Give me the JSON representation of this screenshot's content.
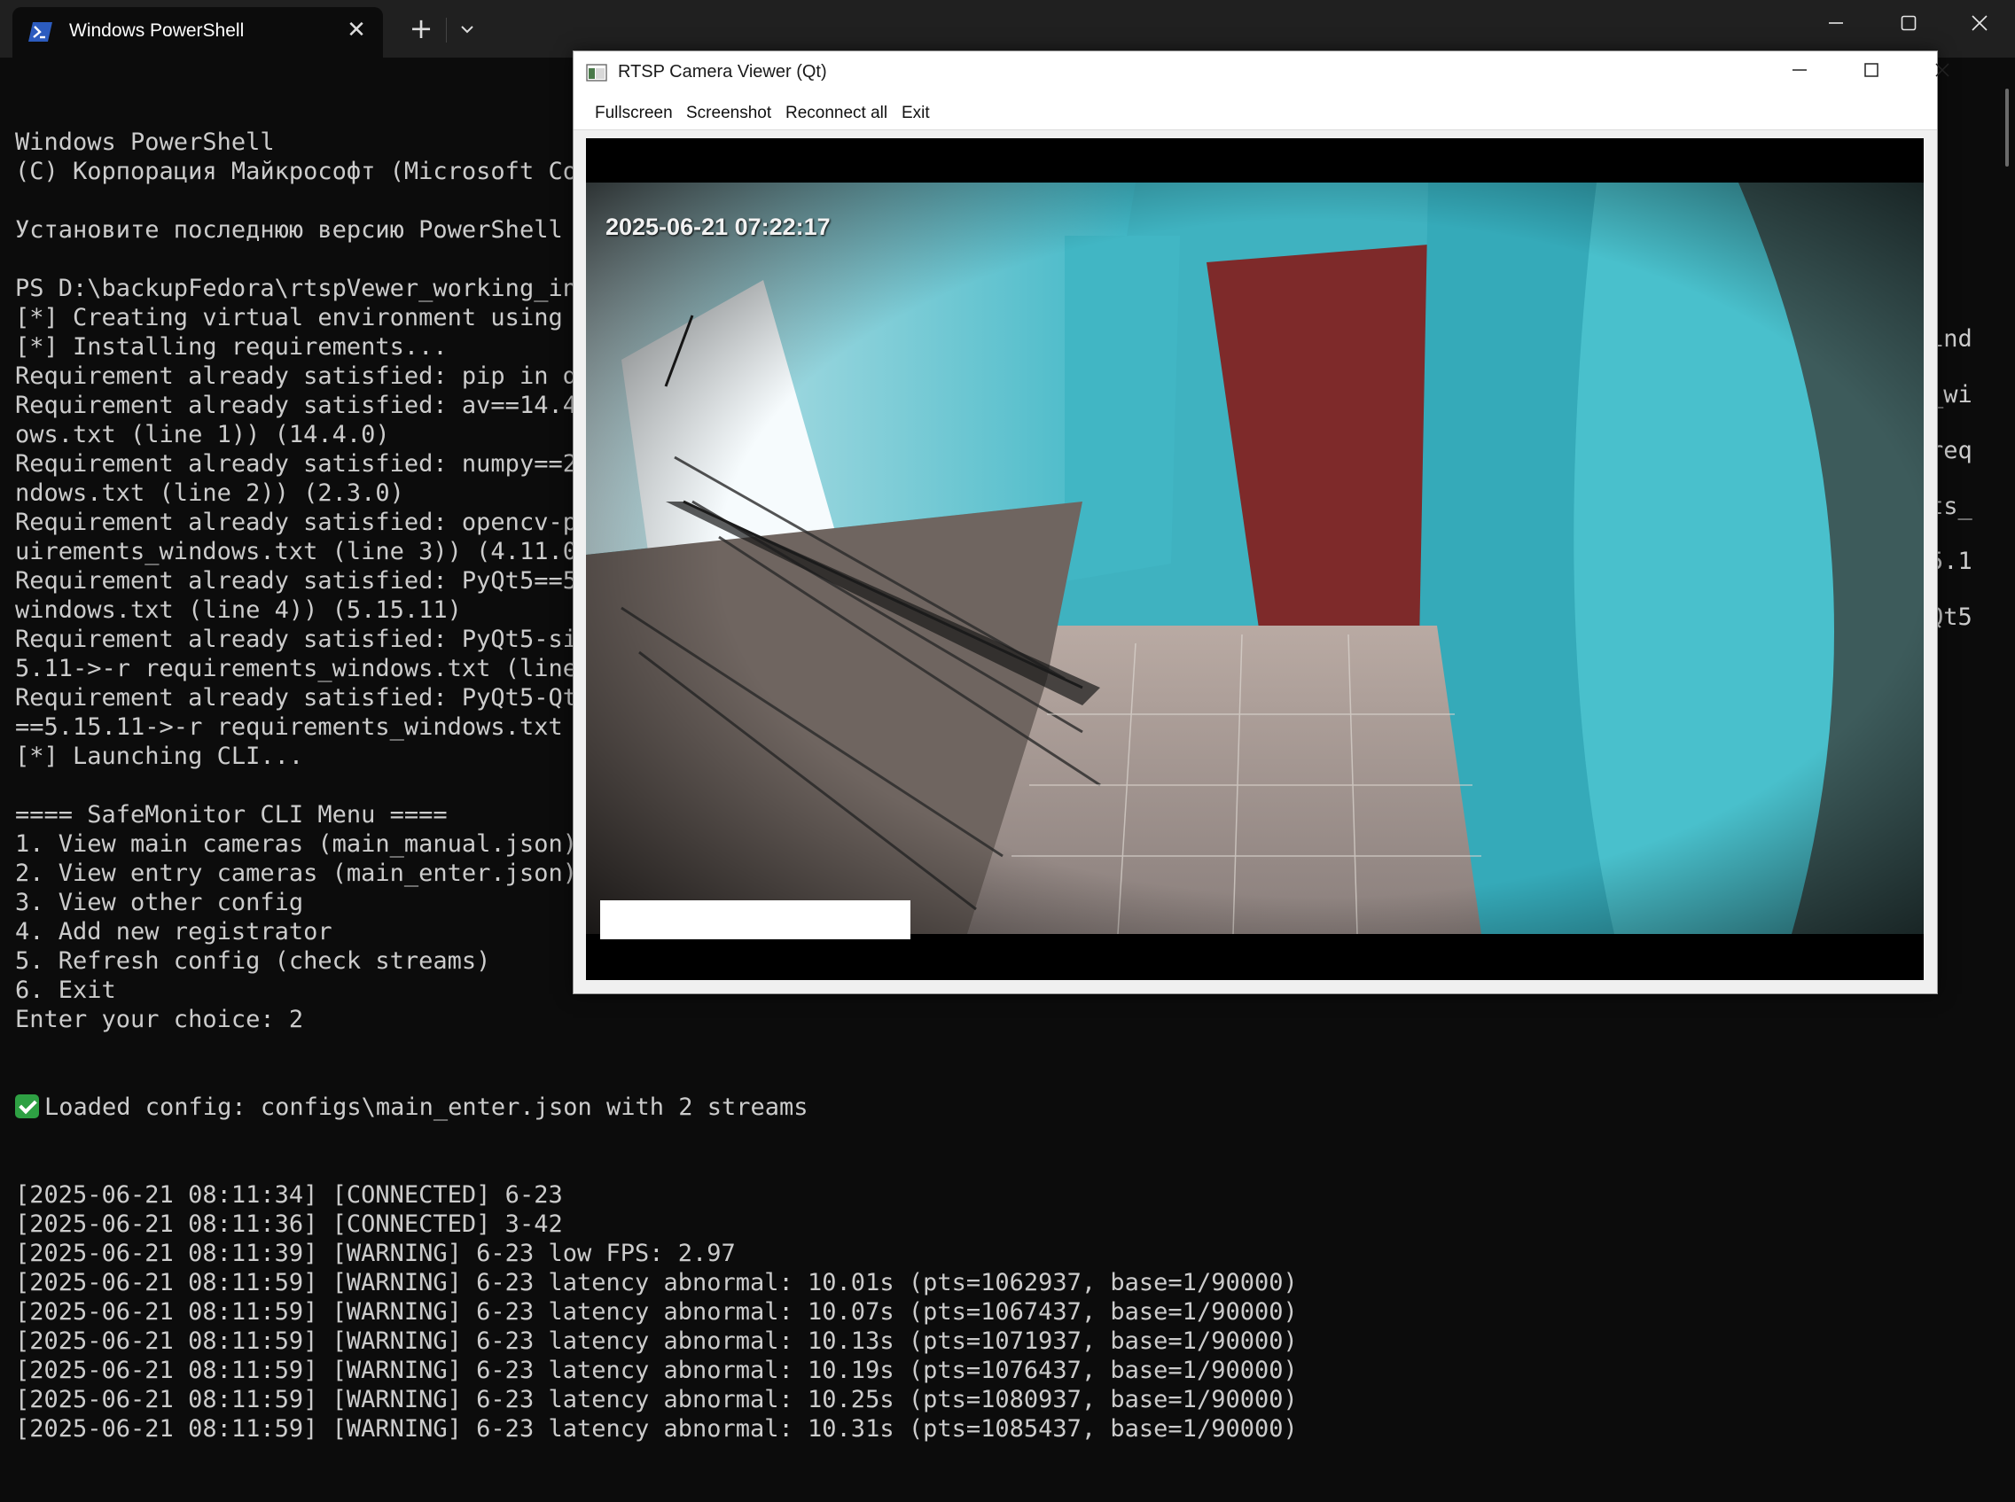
{
  "terminal": {
    "tab_title": "Windows PowerShell",
    "tab_close_glyph": "✕",
    "new_tab_glyph": "+",
    "dropdown_glyph": "⌄",
    "window_controls": {
      "minimize": "—",
      "maximize": "☐",
      "close": "✕"
    },
    "lines": [
      "Windows PowerShell",
      "(C) Корпорация Майкрософт (Microsoft Co",
      "",
      "Установите последнюю версию PowerShell д",
      "",
      "PS D:\\backupFedora\\rtspVewer_working_in",
      "[*] Creating virtual environment using",
      "[*] Installing requirements...",
      "Requirement already satisfied: pip in d",
      "Requirement already satisfied: av==14.4",
      "ows.txt (line 1)) (14.4.0)",
      "Requirement already satisfied: numpy==2",
      "ndows.txt (line 2)) (2.3.0)",
      "Requirement already satisfied: opencv-py",
      "uirements_windows.txt (line 3)) (4.11.0",
      "Requirement already satisfied: PyQt5==5",
      "windows.txt (line 4)) (5.15.11)",
      "Requirement already satisfied: PyQt5-si",
      "5.11->-r requirements_windows.txt (line",
      "Requirement already satisfied: PyQt5-Qt",
      "==5.15.11->-r requirements_windows.txt",
      "[*] Launching CLI...",
      "",
      "==== SafeMonitor CLI Menu ====",
      "1. View main cameras (main_manual.json)",
      "2. View entry cameras (main_enter.json)",
      "3. View other config",
      "4. Add new registrator",
      "5. Refresh config (check streams)",
      "6. Exit",
      "Enter your choice: 2"
    ],
    "loaded_line": "Loaded config: configs\\main_enter.json with 2 streams",
    "log_lines": [
      "[2025-06-21 08:11:34] [CONNECTED] 6-23",
      "[2025-06-21 08:11:36] [CONNECTED] 3-42",
      "[2025-06-21 08:11:39] [WARNING] 6-23 low FPS: 2.97",
      "[2025-06-21 08:11:59] [WARNING] 6-23 latency abnormal: 10.01s (pts=1062937, base=1/90000)",
      "[2025-06-21 08:11:59] [WARNING] 6-23 latency abnormal: 10.07s (pts=1067437, base=1/90000)",
      "[2025-06-21 08:11:59] [WARNING] 6-23 latency abnormal: 10.13s (pts=1071937, base=1/90000)",
      "[2025-06-21 08:11:59] [WARNING] 6-23 latency abnormal: 10.19s (pts=1076437, base=1/90000)",
      "[2025-06-21 08:11:59] [WARNING] 6-23 latency abnormal: 10.25s (pts=1080937, base=1/90000)",
      "[2025-06-21 08:11:59] [WARNING] 6-23 latency abnormal: 10.31s (pts=1085437, base=1/90000)"
    ],
    "right_fragments": [
      "ind",
      "_wi",
      "req",
      "ts_",
      "5.1",
      "Qt5"
    ]
  },
  "viewer": {
    "title": "RTSP Camera Viewer (Qt)",
    "window_controls": {
      "minimize": "—",
      "maximize": "☐",
      "close": "✕"
    },
    "menu": [
      "Fullscreen",
      "Screenshot",
      "Reconnect all",
      "Exit"
    ],
    "osd_timestamp": "2025-06-21 07:22:17"
  },
  "colors": {
    "terminal_bg": "#0c0c0c",
    "terminal_fg": "#cccccc",
    "tabbar_bg": "#202020",
    "check_green": "#2ea043",
    "powershell_blue": "#2c5cbf"
  }
}
